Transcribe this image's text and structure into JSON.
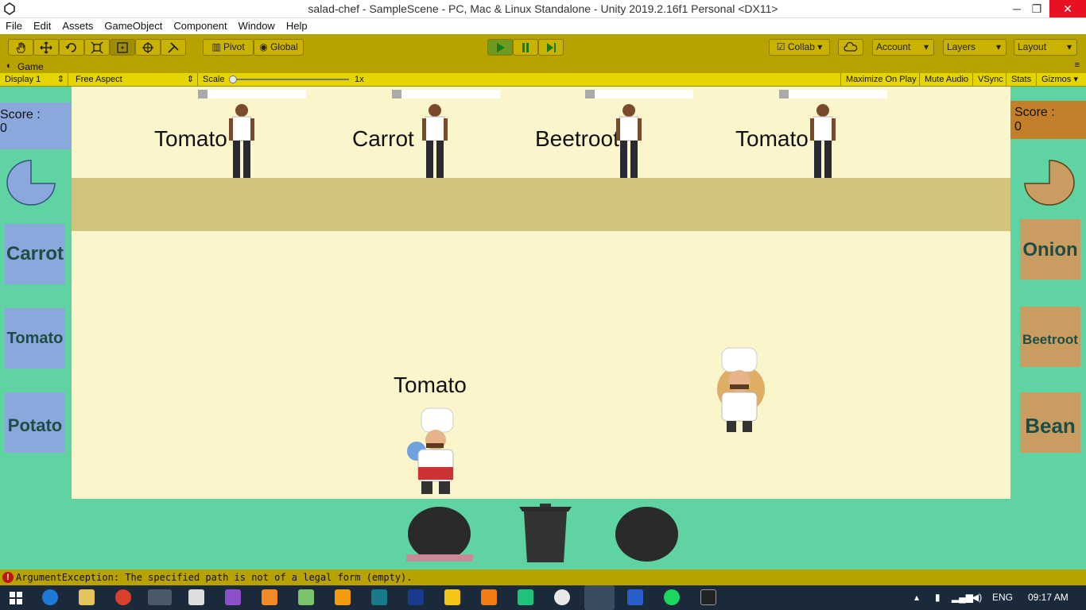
{
  "window": {
    "title": "salad-chef - SampleScene - PC, Mac & Linux Standalone - Unity 2019.2.16f1 Personal <DX11>",
    "minimize": "─",
    "maximize": "❐",
    "close": "✕"
  },
  "menu": [
    "File",
    "Edit",
    "Assets",
    "GameObject",
    "Component",
    "Window",
    "Help"
  ],
  "toolbar": {
    "pivot_label": "Pivot",
    "global_label": "Global",
    "collab_label": "Collab",
    "account_label": "Account",
    "layers_label": "Layers",
    "layout_label": "Layout"
  },
  "game_tab": {
    "label": "Game"
  },
  "game_bar": {
    "display": "Display 1",
    "aspect": "Free Aspect",
    "scale_label": "Scale",
    "scale_value": "1x",
    "maximize": "Maximize On Play",
    "mute": "Mute Audio",
    "vsync": "VSync",
    "stats": "Stats",
    "gizmos": "Gizmos"
  },
  "orders": [
    "Tomato",
    "Carrot",
    "Beetroot",
    "Tomato"
  ],
  "player1": {
    "score_label": "Score :",
    "score_value": "0",
    "vegetables": [
      "Carrot",
      "Tomato",
      "Potato"
    ],
    "held": "Tomato",
    "color": "#8aa8dc"
  },
  "player2": {
    "score_label": "Score :",
    "score_value": "0",
    "vegetables": [
      "Onion",
      "Beetroot",
      "Bean"
    ],
    "color": "#c99d62"
  },
  "console": {
    "message": "ArgumentException: The specified path is not of a legal form (empty)."
  },
  "taskbar": {
    "lang": "ENG",
    "time": "09:17 AM"
  }
}
